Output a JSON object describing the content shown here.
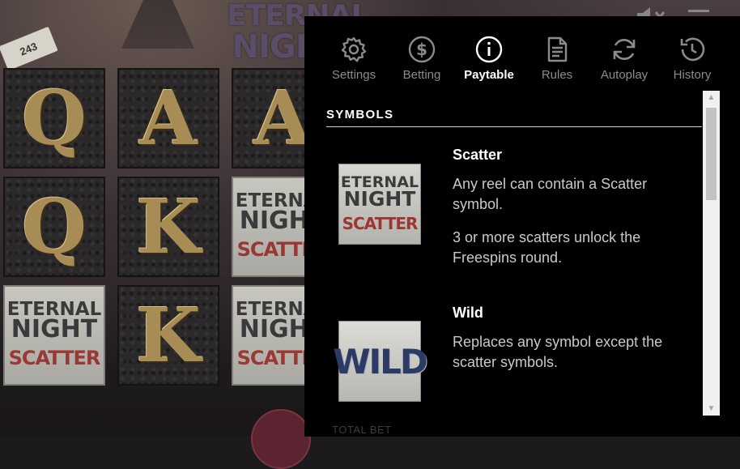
{
  "game": {
    "logo_line1": "ETERNAL",
    "logo_line2": "NIGHT",
    "ticket": "243",
    "reels": [
      [
        "Q",
        "A",
        "A"
      ],
      [
        "Q",
        "K",
        "SCATTER"
      ],
      [
        "SCATTER",
        "K",
        "SCATTER"
      ]
    ],
    "scatter_symbol": {
      "line1": "ETERNAL",
      "line2": "NIGHT",
      "line3": "SCATTER"
    }
  },
  "tabs": [
    {
      "label": "Settings",
      "icon": "gear-icon",
      "active": false
    },
    {
      "label": "Betting",
      "icon": "dollar-circle-icon",
      "active": false
    },
    {
      "label": "Paytable",
      "icon": "info-circle-icon",
      "active": true
    },
    {
      "label": "Rules",
      "icon": "document-icon",
      "active": false
    },
    {
      "label": "Autoplay",
      "icon": "refresh-icon",
      "active": false
    },
    {
      "label": "History",
      "icon": "history-clock-icon",
      "active": false
    }
  ],
  "paytable": {
    "section_title": "SYMBOLS",
    "symbols": [
      {
        "name": "Scatter",
        "image": {
          "line1": "ETERNAL",
          "line2": "NIGHT",
          "line3": "SCATTER"
        },
        "paragraphs": [
          "Any reel can contain a Scatter symbol.",
          "3 or more scatters unlock the Freespins round."
        ]
      },
      {
        "name": "Wild",
        "image": {
          "line1": "WILD"
        },
        "paragraphs": [
          "Replaces any symbol except the scatter symbols."
        ]
      }
    ]
  },
  "footer": {
    "total_bet_label": "TOTAL BET"
  },
  "colors": {
    "panel_bg": "#000000",
    "active_tab": "#ffffff",
    "inactive_tab": "#8b8b8b",
    "scatter_red": "#9b3733",
    "wild_blue": "#2c3a66",
    "letter_gold": "#a88c55"
  }
}
